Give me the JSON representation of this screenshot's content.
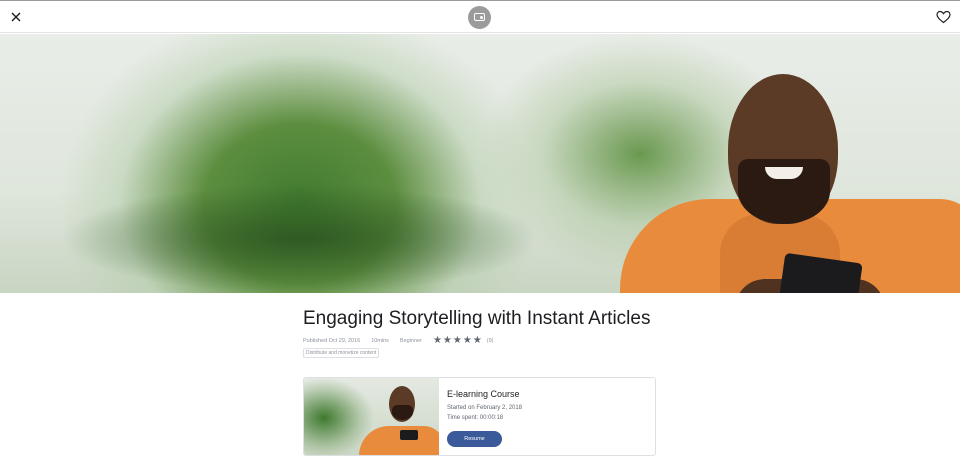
{
  "header": {
    "close_icon": "close-icon",
    "logo_icon": "wallet-icon",
    "favorite_icon": "heart-icon"
  },
  "hero": {
    "image": "man-in-orange-jacket-with-phone"
  },
  "article": {
    "title": "Engaging Storytelling with Instant Articles",
    "published": "Published Oct 29, 2016",
    "duration": "10mins",
    "level": "Beginner",
    "rating": 5,
    "rating_max": 5,
    "rating_count": "(9)",
    "tag": "Distribute and monetize content"
  },
  "course_card": {
    "type": "E-learning Course",
    "started": "Started on February 2, 2018",
    "time_spent": "Time spent: 00:00:18",
    "resume_label": "Resume"
  },
  "colors": {
    "accent": "#3b5a9a",
    "star": "#606770",
    "meta_text": "#8d949e"
  }
}
